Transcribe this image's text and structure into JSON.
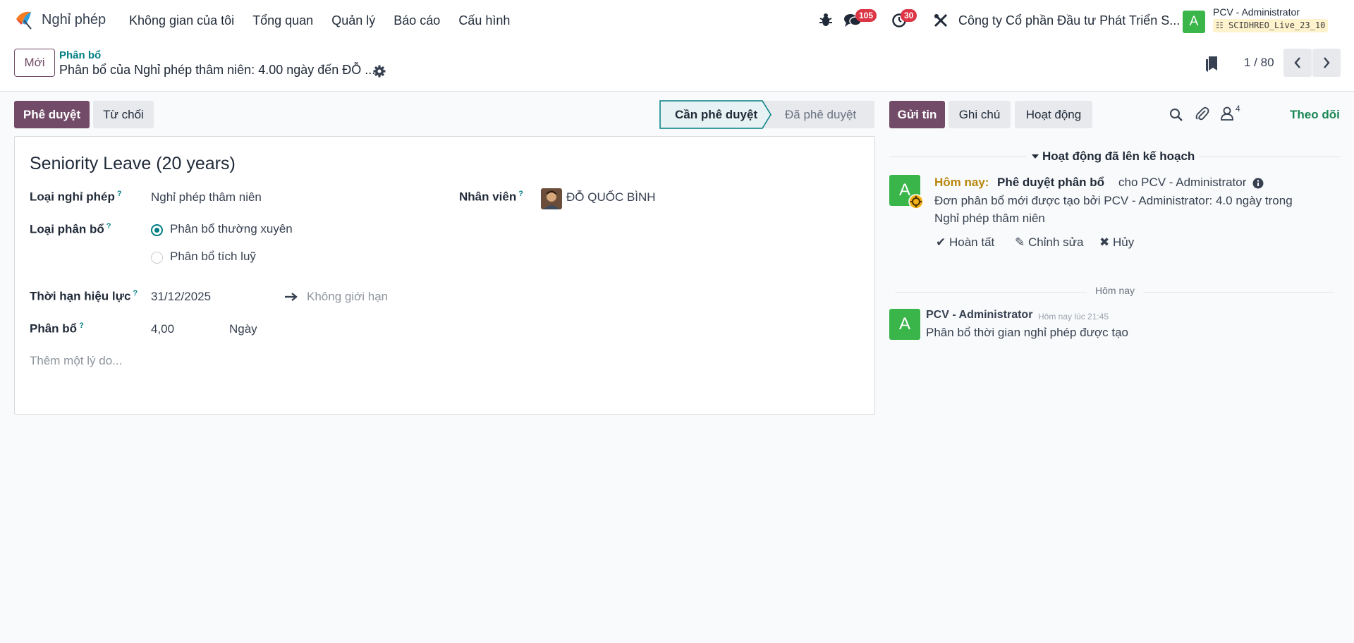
{
  "navbar": {
    "app_name": "Nghỉ phép",
    "menu": [
      "Không gian của tôi",
      "Tổng quan",
      "Quản lý",
      "Báo cáo",
      "Cấu hình"
    ],
    "messages_badge": "105",
    "activities_badge": "30",
    "company": "Công ty Cổ phần Đầu tư Phát Triển S...",
    "user_initial": "A",
    "user_name": "PCV - Administrator",
    "database": "SCIDHREO_Live_23_10"
  },
  "control_panel": {
    "new_button": "Mới",
    "breadcrumb_parent": "Phân bổ",
    "breadcrumb_current": "Phân bổ của Nghỉ phép thâm niên: 4.00 ngày đến ĐỖ ...",
    "pager": "1 / 80"
  },
  "form": {
    "approve_button": "Phê duyệt",
    "refuse_button": "Từ chối",
    "stages": [
      "Cần phê duyệt",
      "Đã phê duyệt"
    ],
    "active_stage": "Cần phê duyệt",
    "title": "Seniority Leave (20 years)",
    "fields": {
      "leave_type_label": "Loại nghỉ phép",
      "leave_type_value": "Nghỉ phép thâm niên",
      "employee_label": "Nhân viên",
      "employee_value": "ĐỖ QUỐC BÌNH",
      "allocation_type_label": "Loại phân bổ",
      "allocation_type_options": [
        "Phân bổ thường xuyên",
        "Phân bổ tích luỹ"
      ],
      "allocation_type_selected": "Phân bổ thường xuyên",
      "validity_label": "Thời hạn hiệu lực",
      "validity_start": "31/12/2025",
      "validity_end_placeholder": "Không giới hạn",
      "allocation_label": "Phân bổ",
      "allocation_value": "4,00",
      "allocation_unit": "Ngày",
      "reason_placeholder": "Thêm một lý do...",
      "help_mark": "?"
    }
  },
  "chatter": {
    "send_button": "Gửi tin",
    "note_button": "Ghi chú",
    "activity_button": "Hoạt động",
    "followers_count": "4",
    "follow_button": "Theo dõi",
    "planned_title": "Hoạt động đã lên kế hoạch",
    "activity": {
      "avatar_initial": "A",
      "when": "Hôm nay:",
      "summary": "Phê duyệt phân bổ",
      "assignee": "cho PCV - Administrator",
      "note_line1": "Đơn phân bổ mới được tạo bởi PCV - Administrator: 4.0 ngày trong",
      "note_line2": "Nghỉ phép thâm niên",
      "done": "Hoàn tất",
      "edit": "Chỉnh sửa",
      "cancel": "Hủy"
    },
    "date_separator": "Hôm nay",
    "message": {
      "avatar_initial": "A",
      "author": "PCV - Administrator",
      "time": "Hôm nay lúc 21:45",
      "body": "Phân bổ thời gian nghỉ phép được tạo"
    }
  },
  "colors": {
    "brand": "#714b67",
    "teal": "#017e84",
    "success": "#198754",
    "badge": "#dc3545",
    "avatar": "#3ab54a"
  }
}
